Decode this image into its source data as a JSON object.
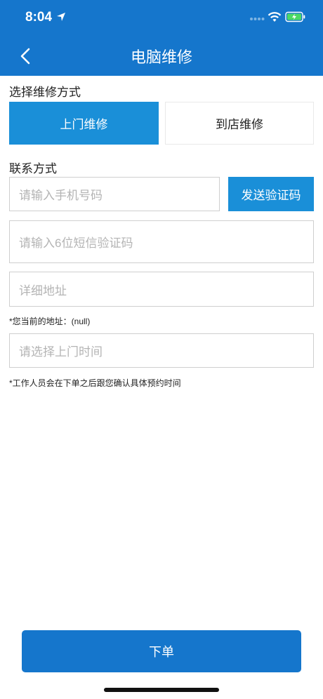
{
  "status_bar": {
    "time": "8:04"
  },
  "nav": {
    "title": "电脑维修"
  },
  "repair_method": {
    "label": "选择维修方式",
    "options": [
      "上门维修",
      "到店维修"
    ],
    "selected": "上门维修"
  },
  "contact": {
    "label": "联系方式",
    "phone_placeholder": "请输入手机号码",
    "send_code_label": "发送验证码",
    "code_placeholder": "请输入6位短信验证码",
    "address_placeholder": "详细地址",
    "current_address_note": "*您当前的地址：(null)",
    "time_placeholder": "请选择上门时间",
    "staff_note": "*工作人员会在下单之后跟您确认具体预约时间"
  },
  "submit_label": "下单",
  "colors": {
    "primary": "#1576CC",
    "accent": "#1A8FD8"
  },
  "icons": [
    "location-arrow-icon",
    "cellular-signal-icon",
    "wifi-icon",
    "battery-charging-icon",
    "back-chevron-icon"
  ]
}
